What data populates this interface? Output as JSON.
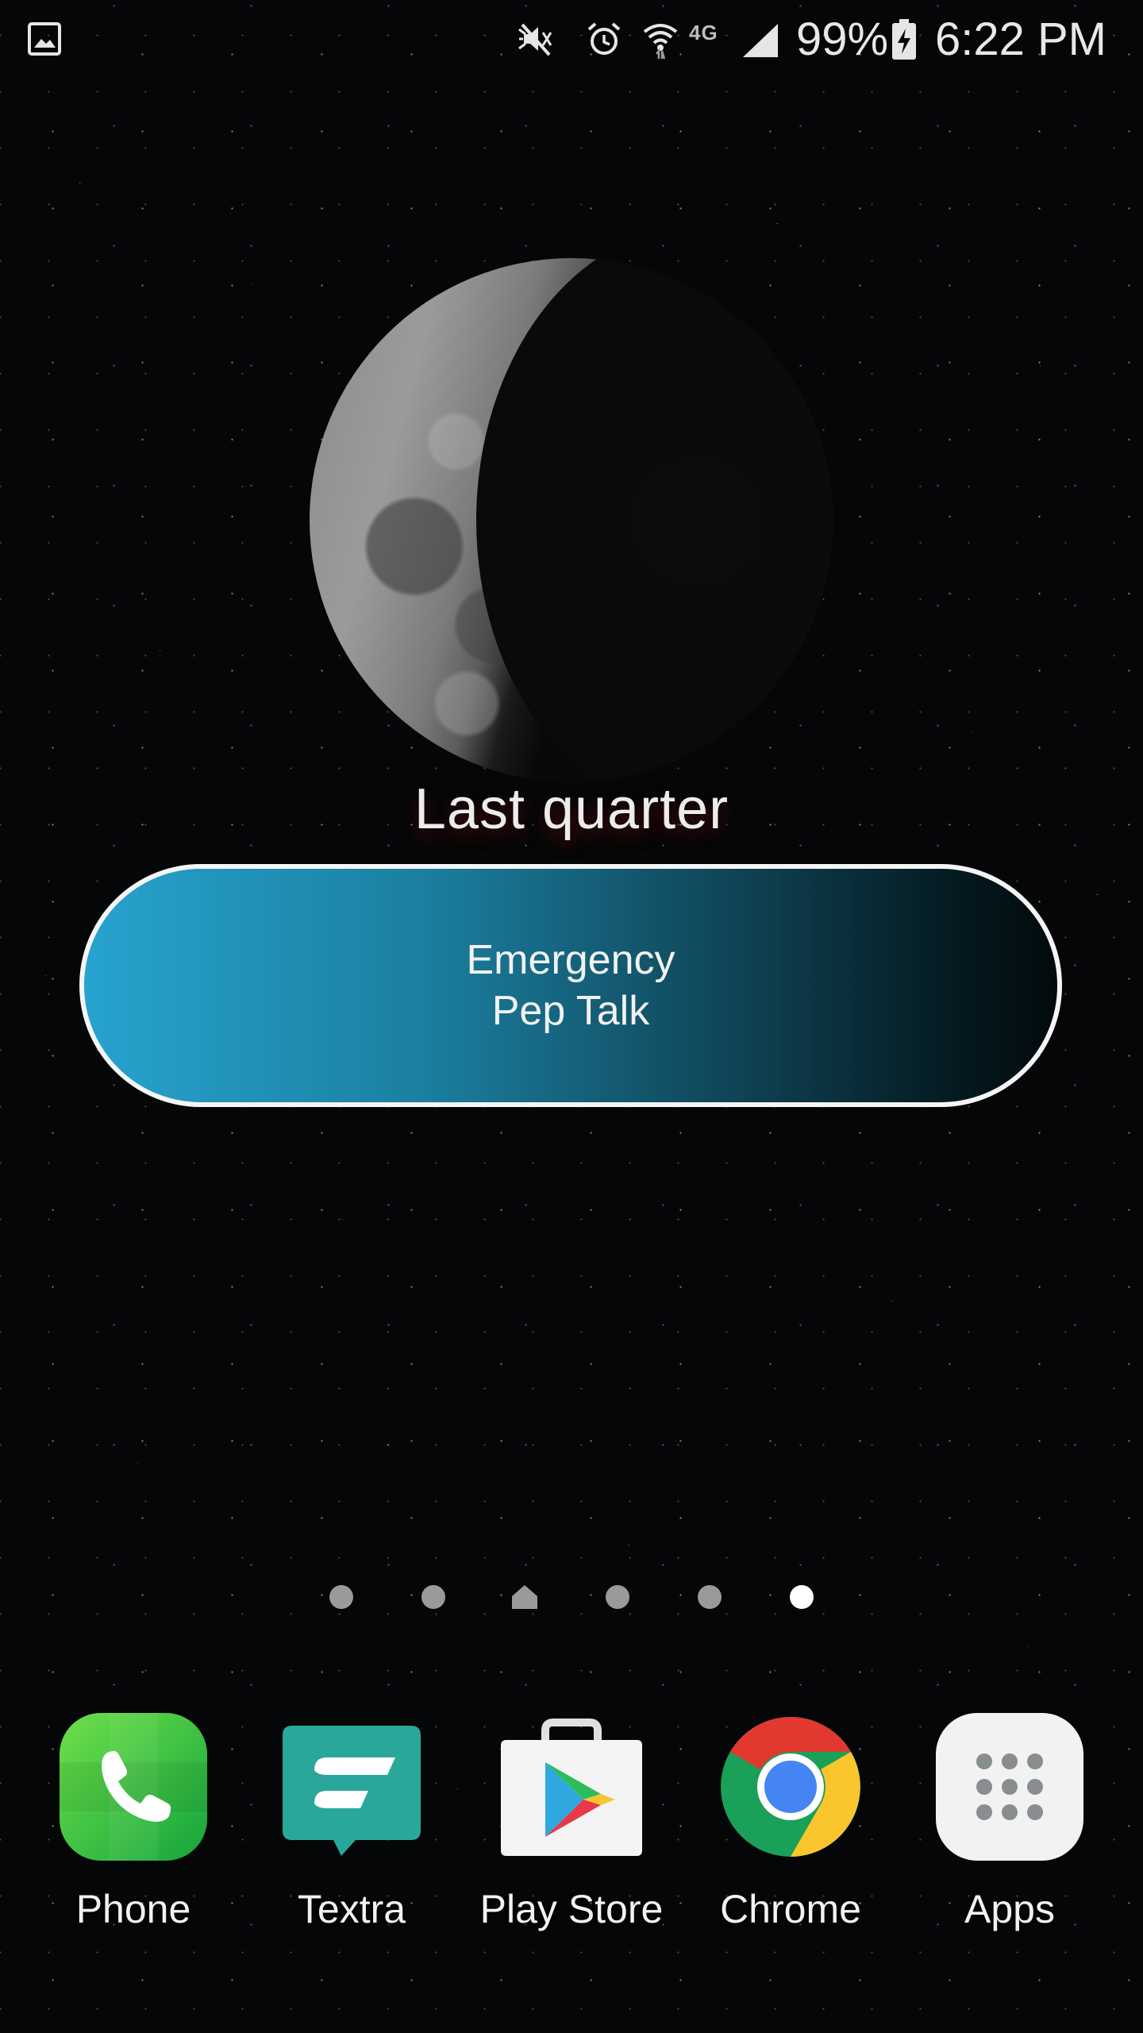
{
  "status_bar": {
    "icons": [
      "gallery-icon",
      "mute-icon",
      "alarm-icon",
      "wifi-icon",
      "signal-icon",
      "battery-charging-icon"
    ],
    "network_type": "4G",
    "battery_percent": "99%",
    "time": "6:22 PM"
  },
  "moon_widget": {
    "phase": "Last quarter"
  },
  "emergency_widget": {
    "line1": "Emergency",
    "line2": "Pep Talk"
  },
  "page_indicator": {
    "pages": 6,
    "home_index": 2,
    "active_index": 5
  },
  "dock": {
    "apps": [
      {
        "label": "Phone",
        "icon": "phone-icon"
      },
      {
        "label": "Textra",
        "icon": "textra-icon"
      },
      {
        "label": "Play Store",
        "icon": "play-store-icon"
      },
      {
        "label": "Chrome",
        "icon": "chrome-icon"
      },
      {
        "label": "Apps",
        "icon": "apps-grid-icon"
      }
    ]
  },
  "colors": {
    "button_gradient_start": "#27a3cf",
    "button_gradient_end": "#020a0c",
    "phone_green": "#3cc94a",
    "textra_teal": "#2aa79b"
  }
}
